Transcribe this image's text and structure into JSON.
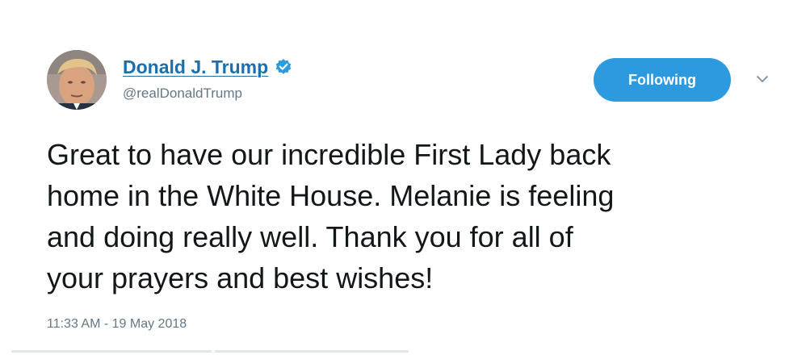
{
  "tweet": {
    "author": {
      "display_name": "Donald J. Trump",
      "screen_name": "@realDonaldTrump",
      "verified": true
    },
    "follow_button_label": "Following",
    "text_lines": [
      "Great to have our incredible First Lady back",
      "home in the White House. Melanie is feeling",
      "and doing really well. Thank you for all of",
      "your prayers and best wishes!"
    ],
    "timestamp": "11:33 AM - 19 May 2018",
    "icons": {
      "verified": "verified-badge-icon",
      "menu": "chevron-down-icon"
    }
  },
  "colors": {
    "link": "#1b6fad",
    "accent": "#2d9ae0",
    "muted": "#657786",
    "text": "#14171a"
  }
}
